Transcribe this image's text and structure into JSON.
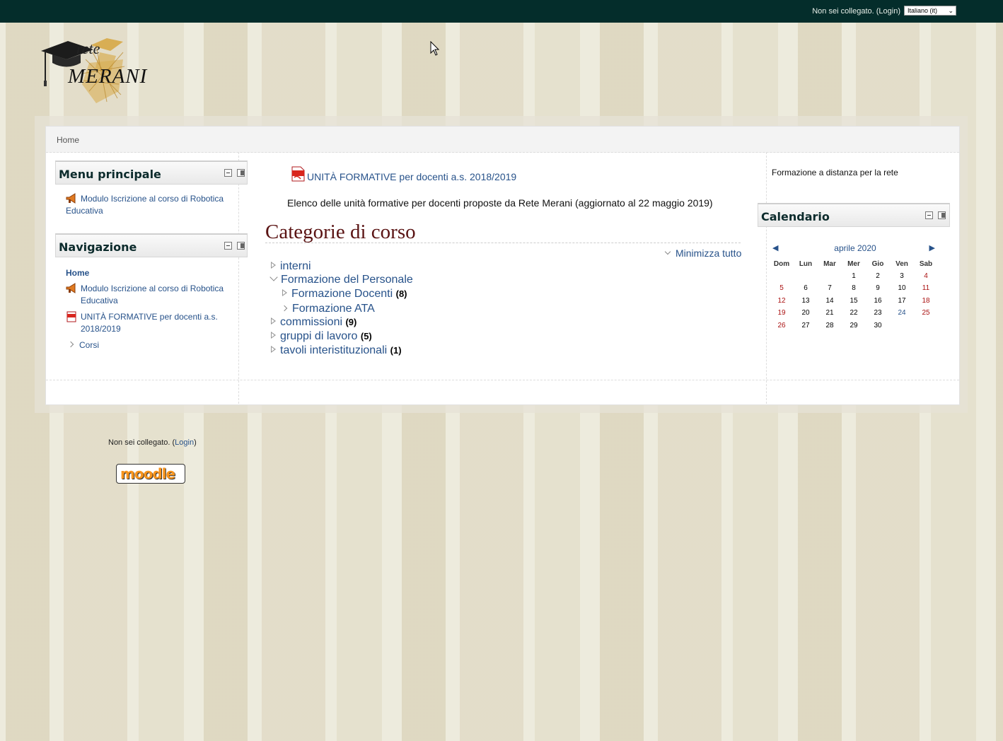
{
  "topbar": {
    "login_prefix": "Non sei collegato. (",
    "login_link": "Login",
    "login_suffix": ")",
    "language": "Italiano (it)"
  },
  "logo": {
    "line1": "rete",
    "line2": "MERANI"
  },
  "breadcrumb": {
    "home": "Home"
  },
  "left": {
    "menu_block": {
      "title": "Menu principale",
      "items": [
        {
          "label": "Modulo Iscrizione al corso di Robotica Educativa",
          "icon": "megaphone-icon"
        }
      ]
    },
    "nav_block": {
      "title": "Navigazione",
      "home": "Home",
      "items": [
        {
          "label": "Modulo Iscrizione al corso di Robotica Educativa",
          "icon": "megaphone-icon"
        },
        {
          "label": "UNITÀ FORMATIVE per docenti a.s. 2018/2019",
          "icon": "pdf-icon"
        }
      ],
      "corsi": "Corsi"
    }
  },
  "main": {
    "resource_link": "UNITÀ FORMATIVE per docenti a.s. 2018/2019",
    "resource_desc": "Elenco delle unità formative per docenti proposte da Rete Merani (aggiornato al 22 maggio 2019)",
    "categories_title": "Categorie di corso",
    "collapse_all": "Minimizza tutto",
    "categories": [
      {
        "name": "interni",
        "count": ""
      },
      {
        "name": "Formazione del Personale",
        "count": ""
      },
      {
        "name": "Formazione Docenti",
        "count": "(8)"
      },
      {
        "name": "Formazione ATA",
        "count": ""
      },
      {
        "name": "commissioni",
        "count": "(9)"
      },
      {
        "name": "gruppi di lavoro",
        "count": "(5)"
      },
      {
        "name": "tavoli interistituzionali",
        "count": "(1)"
      }
    ]
  },
  "right": {
    "site_summary": "Formazione a distanza per la rete",
    "calendar": {
      "title": "Calendario",
      "prev": "◀",
      "next": "▶",
      "month": "aprile 2020",
      "weekdays": [
        "Dom",
        "Lun",
        "Mar",
        "Mer",
        "Gio",
        "Ven",
        "Sab"
      ],
      "weeks": [
        [
          "",
          "",
          "",
          "1",
          "2",
          "3",
          "4"
        ],
        [
          "5",
          "6",
          "7",
          "8",
          "9",
          "10",
          "11"
        ],
        [
          "12",
          "13",
          "14",
          "15",
          "16",
          "17",
          "18"
        ],
        [
          "19",
          "20",
          "21",
          "22",
          "23",
          "24",
          "25"
        ],
        [
          "26",
          "27",
          "28",
          "29",
          "30",
          "",
          ""
        ]
      ],
      "today": "24",
      "weekend_color": "#aa1111",
      "link_color": "#27528a"
    }
  },
  "footer": {
    "login_prefix": "Non sei collegato. (",
    "login_link": "Login",
    "login_suffix": ")",
    "moodle_logo": "moodle"
  },
  "colors": {
    "topbar": "#042d2b",
    "link": "#27528a",
    "category_title": "#5a1313",
    "background": "#efede0"
  }
}
